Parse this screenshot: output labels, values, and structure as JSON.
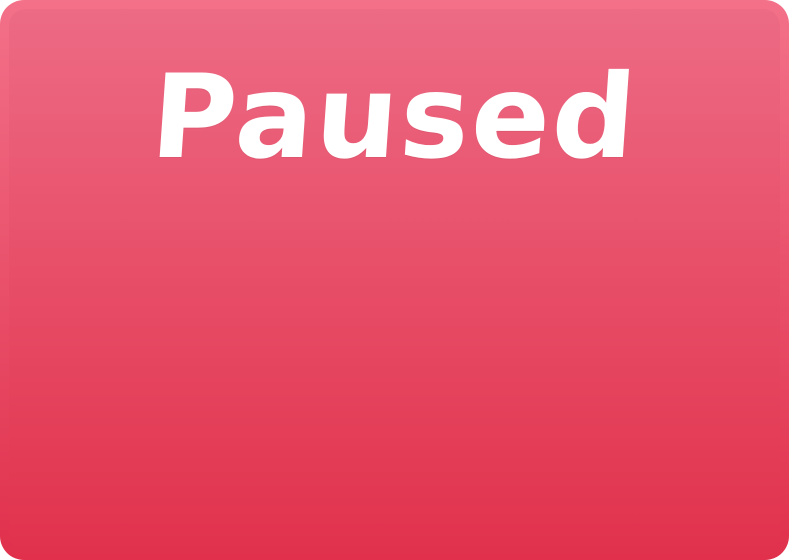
{
  "pause_screen": {
    "title": "Paused"
  },
  "colors": {
    "panel_border_top": "#f37189",
    "panel_border_bottom": "#e0304c",
    "panel_fill_top": "#ed6b85",
    "panel_fill_bottom": "#e1324d",
    "title_text": "#ffffff"
  }
}
